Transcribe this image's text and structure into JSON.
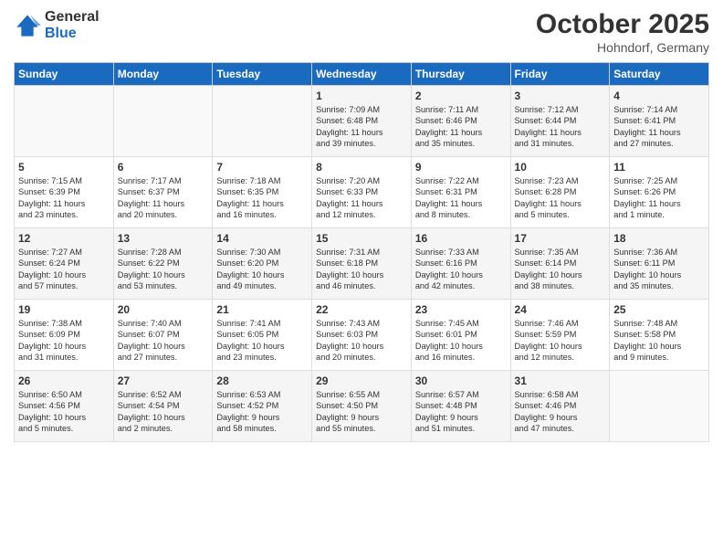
{
  "logo": {
    "general": "General",
    "blue": "Blue"
  },
  "title": "October 2025",
  "location": "Hohndorf, Germany",
  "days_header": [
    "Sunday",
    "Monday",
    "Tuesday",
    "Wednesday",
    "Thursday",
    "Friday",
    "Saturday"
  ],
  "weeks": [
    [
      {
        "day": "",
        "content": ""
      },
      {
        "day": "",
        "content": ""
      },
      {
        "day": "",
        "content": ""
      },
      {
        "day": "1",
        "content": "Sunrise: 7:09 AM\nSunset: 6:48 PM\nDaylight: 11 hours\nand 39 minutes."
      },
      {
        "day": "2",
        "content": "Sunrise: 7:11 AM\nSunset: 6:46 PM\nDaylight: 11 hours\nand 35 minutes."
      },
      {
        "day": "3",
        "content": "Sunrise: 7:12 AM\nSunset: 6:44 PM\nDaylight: 11 hours\nand 31 minutes."
      },
      {
        "day": "4",
        "content": "Sunrise: 7:14 AM\nSunset: 6:41 PM\nDaylight: 11 hours\nand 27 minutes."
      }
    ],
    [
      {
        "day": "5",
        "content": "Sunrise: 7:15 AM\nSunset: 6:39 PM\nDaylight: 11 hours\nand 23 minutes."
      },
      {
        "day": "6",
        "content": "Sunrise: 7:17 AM\nSunset: 6:37 PM\nDaylight: 11 hours\nand 20 minutes."
      },
      {
        "day": "7",
        "content": "Sunrise: 7:18 AM\nSunset: 6:35 PM\nDaylight: 11 hours\nand 16 minutes."
      },
      {
        "day": "8",
        "content": "Sunrise: 7:20 AM\nSunset: 6:33 PM\nDaylight: 11 hours\nand 12 minutes."
      },
      {
        "day": "9",
        "content": "Sunrise: 7:22 AM\nSunset: 6:31 PM\nDaylight: 11 hours\nand 8 minutes."
      },
      {
        "day": "10",
        "content": "Sunrise: 7:23 AM\nSunset: 6:28 PM\nDaylight: 11 hours\nand 5 minutes."
      },
      {
        "day": "11",
        "content": "Sunrise: 7:25 AM\nSunset: 6:26 PM\nDaylight: 11 hours\nand 1 minute."
      }
    ],
    [
      {
        "day": "12",
        "content": "Sunrise: 7:27 AM\nSunset: 6:24 PM\nDaylight: 10 hours\nand 57 minutes."
      },
      {
        "day": "13",
        "content": "Sunrise: 7:28 AM\nSunset: 6:22 PM\nDaylight: 10 hours\nand 53 minutes."
      },
      {
        "day": "14",
        "content": "Sunrise: 7:30 AM\nSunset: 6:20 PM\nDaylight: 10 hours\nand 49 minutes."
      },
      {
        "day": "15",
        "content": "Sunrise: 7:31 AM\nSunset: 6:18 PM\nDaylight: 10 hours\nand 46 minutes."
      },
      {
        "day": "16",
        "content": "Sunrise: 7:33 AM\nSunset: 6:16 PM\nDaylight: 10 hours\nand 42 minutes."
      },
      {
        "day": "17",
        "content": "Sunrise: 7:35 AM\nSunset: 6:14 PM\nDaylight: 10 hours\nand 38 minutes."
      },
      {
        "day": "18",
        "content": "Sunrise: 7:36 AM\nSunset: 6:11 PM\nDaylight: 10 hours\nand 35 minutes."
      }
    ],
    [
      {
        "day": "19",
        "content": "Sunrise: 7:38 AM\nSunset: 6:09 PM\nDaylight: 10 hours\nand 31 minutes."
      },
      {
        "day": "20",
        "content": "Sunrise: 7:40 AM\nSunset: 6:07 PM\nDaylight: 10 hours\nand 27 minutes."
      },
      {
        "day": "21",
        "content": "Sunrise: 7:41 AM\nSunset: 6:05 PM\nDaylight: 10 hours\nand 23 minutes."
      },
      {
        "day": "22",
        "content": "Sunrise: 7:43 AM\nSunset: 6:03 PM\nDaylight: 10 hours\nand 20 minutes."
      },
      {
        "day": "23",
        "content": "Sunrise: 7:45 AM\nSunset: 6:01 PM\nDaylight: 10 hours\nand 16 minutes."
      },
      {
        "day": "24",
        "content": "Sunrise: 7:46 AM\nSunset: 5:59 PM\nDaylight: 10 hours\nand 12 minutes."
      },
      {
        "day": "25",
        "content": "Sunrise: 7:48 AM\nSunset: 5:58 PM\nDaylight: 10 hours\nand 9 minutes."
      }
    ],
    [
      {
        "day": "26",
        "content": "Sunrise: 6:50 AM\nSunset: 4:56 PM\nDaylight: 10 hours\nand 5 minutes."
      },
      {
        "day": "27",
        "content": "Sunrise: 6:52 AM\nSunset: 4:54 PM\nDaylight: 10 hours\nand 2 minutes."
      },
      {
        "day": "28",
        "content": "Sunrise: 6:53 AM\nSunset: 4:52 PM\nDaylight: 9 hours\nand 58 minutes."
      },
      {
        "day": "29",
        "content": "Sunrise: 6:55 AM\nSunset: 4:50 PM\nDaylight: 9 hours\nand 55 minutes."
      },
      {
        "day": "30",
        "content": "Sunrise: 6:57 AM\nSunset: 4:48 PM\nDaylight: 9 hours\nand 51 minutes."
      },
      {
        "day": "31",
        "content": "Sunrise: 6:58 AM\nSunset: 4:46 PM\nDaylight: 9 hours\nand 47 minutes."
      },
      {
        "day": "",
        "content": ""
      }
    ]
  ]
}
